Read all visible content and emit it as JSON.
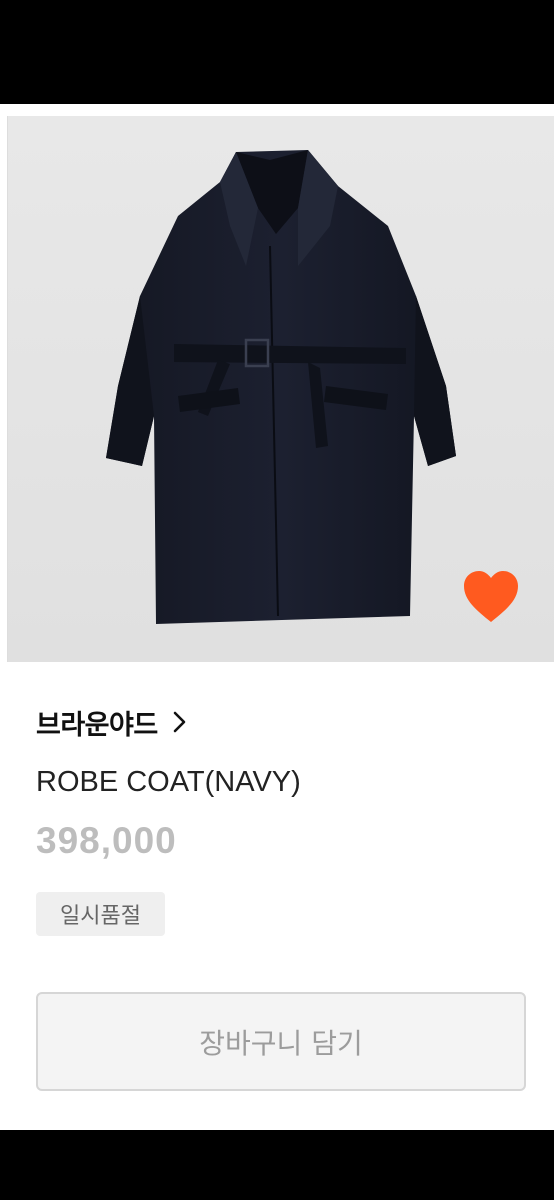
{
  "product": {
    "image_icon": "navy-robe-coat-photo",
    "wishlist_icon": "heart-icon",
    "wishlist_color": "#ff5a1f",
    "brand": "브라운야드",
    "brand_chevron_icon": "chevron-right-icon",
    "name": "ROBE COAT(NAVY)",
    "price": "398,000",
    "status": "일시품절"
  },
  "actions": {
    "add_to_cart_label": "장바구니 담기"
  }
}
